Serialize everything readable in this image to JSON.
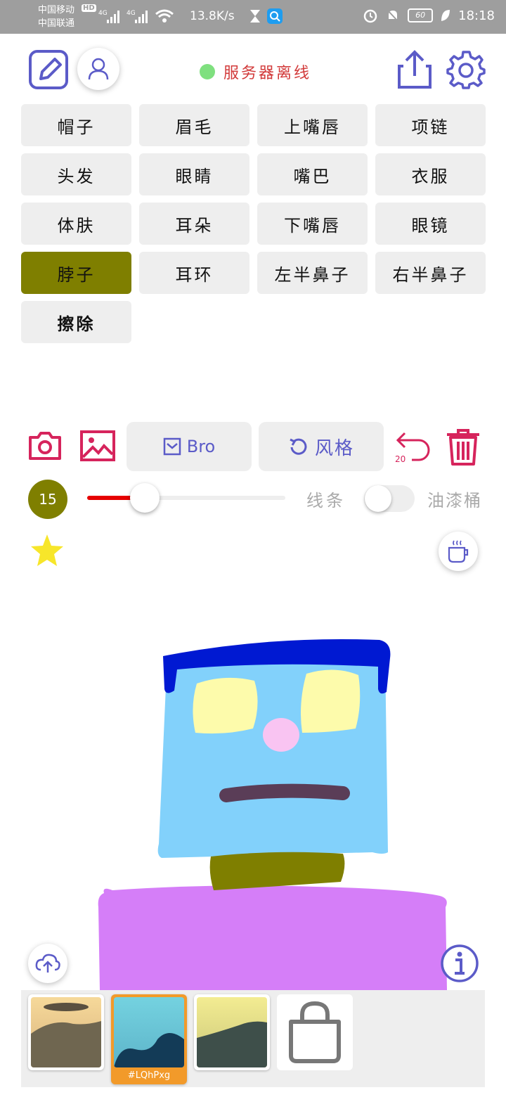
{
  "status_bar": {
    "carrier_1": "中国移动",
    "carrier_2": "中国联通",
    "hd": "HD",
    "net_1": "4G",
    "net_2": "4G",
    "speed": "13.8K/s",
    "battery": "60",
    "time": "18:18"
  },
  "header": {
    "server_status": "服务器离线",
    "status_color": "#7fe07f"
  },
  "parts": [
    {
      "label": "帽子"
    },
    {
      "label": "眉毛"
    },
    {
      "label": "上嘴唇"
    },
    {
      "label": "项链"
    },
    {
      "label": "头发"
    },
    {
      "label": "眼睛"
    },
    {
      "label": "嘴巴"
    },
    {
      "label": "衣服"
    },
    {
      "label": "体肤"
    },
    {
      "label": "耳朵"
    },
    {
      "label": "下嘴唇"
    },
    {
      "label": "眼镜"
    },
    {
      "label": "脖子",
      "active": true
    },
    {
      "label": "耳环"
    },
    {
      "label": "左半鼻子"
    },
    {
      "label": "右半鼻子"
    },
    {
      "label": "擦除"
    }
  ],
  "toolbar": {
    "bro_label": "Bro",
    "style_label": "风格",
    "undo_count": "20"
  },
  "brush": {
    "size": "15",
    "slider_fraction": 0.29,
    "line_label": "线条",
    "bucket_label": "油漆桶",
    "bucket_enabled": false
  },
  "colors": {
    "accent": "#7f7f00",
    "action_red": "#d6245c",
    "icon_purple": "#5b5bc8"
  },
  "gallery": {
    "items": [
      {
        "label": ""
      },
      {
        "label": "#LQhPxg",
        "selected": true
      },
      {
        "label": ""
      }
    ],
    "shop_icon": "shopping-bag-icon"
  }
}
